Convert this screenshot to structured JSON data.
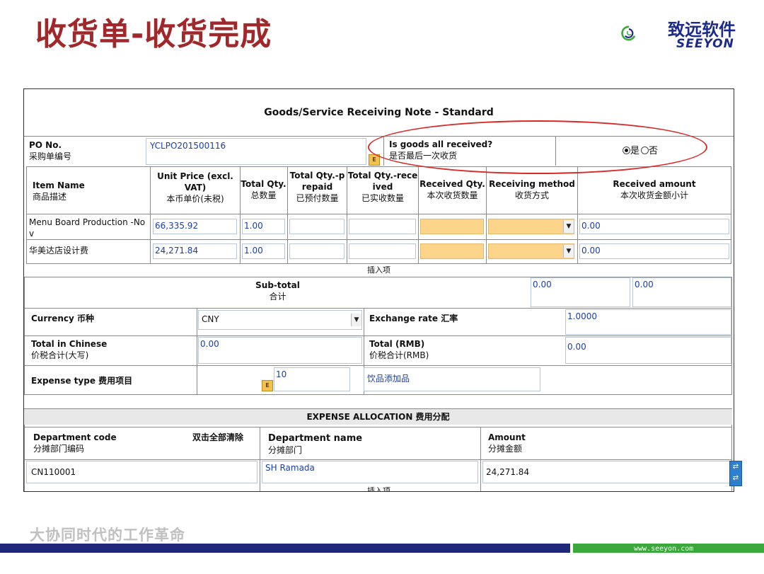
{
  "slide": {
    "title": "收货单-收货完成",
    "logo_cn": "致远软件",
    "logo_en": "SEEYON",
    "slogan": "大协同时代的工作革命",
    "url": "www.seeyon.com"
  },
  "form": {
    "title": "Goods/Service Receiving Note - Standard",
    "po_label_en": "PO No.",
    "po_label_zh": "采购单编号",
    "po_value": "YCLPO201500116",
    "all_received_en": "Is goods all received?",
    "all_received_zh": "是否最后一次收货",
    "radio_yes": "是",
    "radio_no": "否",
    "columns": [
      {
        "en": "Item Name",
        "zh": "商品描述"
      },
      {
        "en": "Unit Price (excl. VAT)",
        "zh": "本币单价(未税)"
      },
      {
        "en": "Total Qty.",
        "zh": "总数量"
      },
      {
        "en": "Total Qty.-prepaid",
        "zh": "已预付数量"
      },
      {
        "en": "Total Qty.-received",
        "zh": "已实收数量"
      },
      {
        "en": "Received Qty.",
        "zh": "本次收货数量"
      },
      {
        "en": "Receiving method",
        "zh": "收货方式"
      },
      {
        "en": "Received amount",
        "zh": "本次收货金额小计"
      }
    ],
    "rows": [
      {
        "item": "Menu Board Production -Nov",
        "unit_price": "66,335.92",
        "total_qty": "1.00",
        "amount": "0.00"
      },
      {
        "item": "华美达店设计费",
        "unit_price": "24,271.84",
        "total_qty": "1.00",
        "amount": "0.00"
      }
    ],
    "insert_item": "插入项",
    "subtotal_en": "Sub-total",
    "subtotal_zh": "合计",
    "subtotal_val1": "0.00",
    "subtotal_val2": "0.00",
    "currency_label": "Currency 币种",
    "currency_value": "CNY",
    "exchange_label": "Exchange rate 汇率",
    "exchange_value": "1.0000",
    "total_cn_en": "Total in Chinese",
    "total_cn_zh": "价税合计(大写)",
    "total_cn_value": "0.00",
    "total_rmb_en": "Total (RMB)",
    "total_rmb_zh": "价税合计(RMB)",
    "total_rmb_value": "0.00",
    "expense_label": "Expense type 费用项目",
    "expense_code": "10",
    "expense_name": "饮品添加品"
  },
  "allocation": {
    "title": "EXPENSE ALLOCATION 费用分配",
    "dept_code_en": "Department code",
    "dept_code_zh": "分摊部门编码",
    "clear_all": "双击全部清除",
    "dept_name_en": "Department name",
    "dept_name_zh": "分摊部门",
    "amount_en": "Amount",
    "amount_zh": "分摊金额",
    "row_code": "CN110001",
    "row_name": "SH Ramada",
    "row_amount": "24,271.84",
    "insert_item": "插入项"
  },
  "colors": {
    "title_red": "#a0282a",
    "brand_blue": "#21287a",
    "brand_green": "#3aa83a",
    "highlight_yellow": "#fcd58b",
    "value_blue": "#1b3ea8",
    "ellipse_red": "#d92a2a"
  }
}
